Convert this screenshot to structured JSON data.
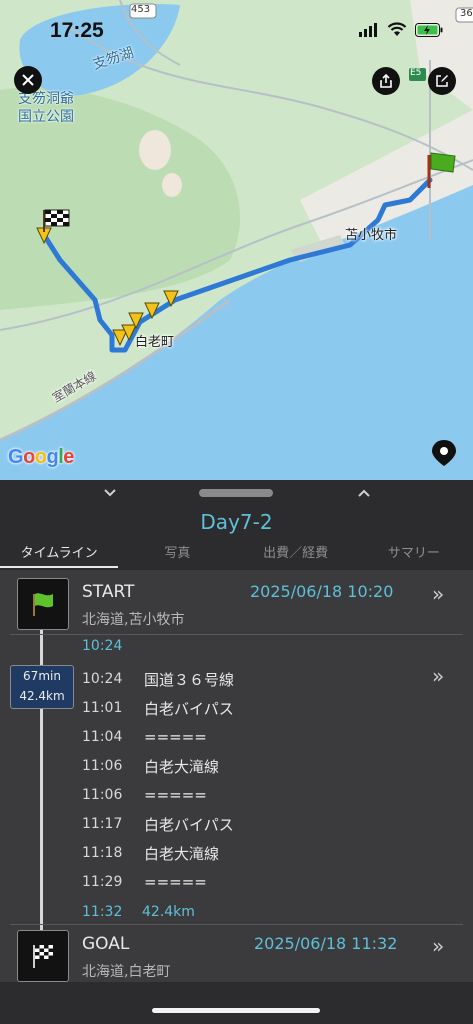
{
  "status": {
    "time": "17:25"
  },
  "map": {
    "labels": {
      "lake": "支笏湖",
      "park_line1": "支笏洞爺",
      "park_line2": "国立公園",
      "tomakomai": "苫小牧市",
      "shiraoi": "白老町",
      "railway": "室蘭本線",
      "route453": "453",
      "routeE5": "E5",
      "route36": "36"
    },
    "google": {
      "G": "G",
      "o1": "o",
      "o2": "o",
      "g": "g",
      "l": "l",
      "e": "e"
    },
    "colors": {
      "land": "#cfe7c8",
      "water": "#8cc9ef",
      "route": "#2e79d6",
      "sand": "#efe6dc"
    }
  },
  "panel": {
    "title": "Day7-2",
    "tabs": [
      {
        "label": "タイムライン"
      },
      {
        "label": "写真"
      },
      {
        "label": "出費／経費"
      },
      {
        "label": "サマリー"
      }
    ],
    "start": {
      "name": "START",
      "place": "北海道,苫小牧市",
      "datetime": "2025/06/18 10:20",
      "depart_time": "10:24"
    },
    "duration": {
      "minutes": "67min",
      "distance": "42.4km"
    },
    "route_steps": [
      {
        "time": "10:24",
        "road": "国道３６号線"
      },
      {
        "time": "11:01",
        "road": "白老バイパス"
      },
      {
        "time": "11:04",
        "road": "====="
      },
      {
        "time": "11:06",
        "road": "白老大滝線"
      },
      {
        "time": "11:06",
        "road": "====="
      },
      {
        "time": "11:17",
        "road": "白老バイパス"
      },
      {
        "time": "11:18",
        "road": "白老大滝線"
      },
      {
        "time": "11:29",
        "road": "====="
      }
    ],
    "arrival": {
      "time": "11:32",
      "distance": "42.4km"
    },
    "goal": {
      "name": "GOAL",
      "place": "北海道,白老町",
      "datetime": "2025/06/18 11:32"
    },
    "chevron": "»",
    "colors": {
      "accent": "#5ec0d8",
      "badge": "#1f3a63"
    }
  }
}
